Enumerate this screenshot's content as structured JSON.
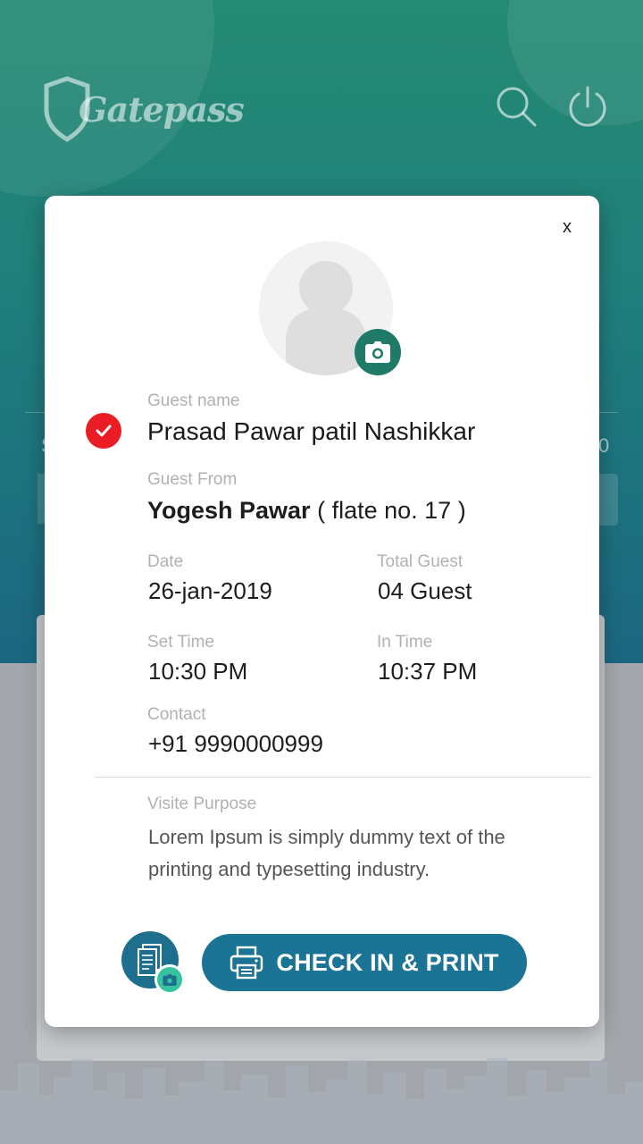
{
  "app": {
    "logo_text": "Gatepass"
  },
  "background": {
    "left_char": "S",
    "right_char": "0"
  },
  "modal": {
    "close_label": "x",
    "guest_name_label": "Guest name",
    "guest_name": "Prasad Pawar patil Nashikkar",
    "guest_from_label": "Guest From",
    "guest_from_name": "Yogesh Pawar",
    "guest_from_flat": "( flate no. 17 )",
    "date_label": "Date",
    "date_value": "26-jan-2019",
    "total_guest_label": "Total Guest",
    "total_guest_value": "04 Guest",
    "set_time_label": "Set Time",
    "set_time_value": "10:30 PM",
    "in_time_label": "In Time",
    "in_time_value": "10:37 PM",
    "contact_label": "Contact",
    "contact_value": "+91 9990000999",
    "purpose_label": "Visite Purpose",
    "purpose_text": "Lorem Ipsum is simply dummy text of the printing and typesetting industry.",
    "checkin_button_label": "CHECK IN & PRINT"
  },
  "colors": {
    "header_top": "#248a72",
    "header_bottom": "#1b6680",
    "primary_button": "#1b7496",
    "camera_badge": "#1f7a68",
    "verified": "#ea1c24",
    "scan_camera": "#35c3a0"
  },
  "icons": [
    "shield-logo-icon",
    "search-icon",
    "power-icon",
    "close-icon",
    "avatar-icon",
    "camera-icon",
    "check-icon",
    "document-scan-icon",
    "printer-icon"
  ]
}
